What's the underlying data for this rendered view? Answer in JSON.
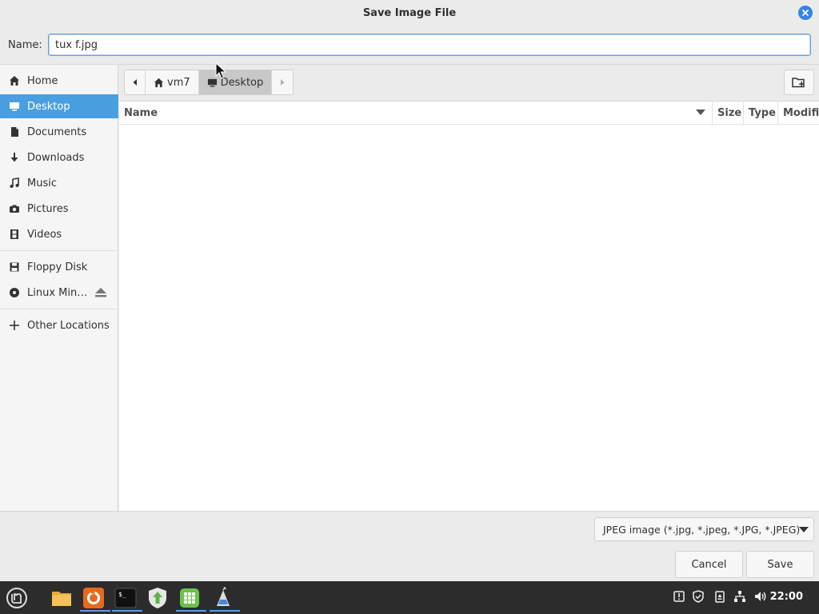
{
  "dialog": {
    "title": "Save Image File",
    "name_label": "Name:",
    "name_value": "tux f.jpg"
  },
  "sidebar": {
    "items": [
      {
        "label": "Home",
        "icon": "home-icon"
      },
      {
        "label": "Desktop",
        "icon": "desktop-icon",
        "active": true
      },
      {
        "label": "Documents",
        "icon": "documents-icon"
      },
      {
        "label": "Downloads",
        "icon": "downloads-icon"
      },
      {
        "label": "Music",
        "icon": "music-icon"
      },
      {
        "label": "Pictures",
        "icon": "camera-icon"
      },
      {
        "label": "Videos",
        "icon": "film-icon"
      }
    ],
    "devices": [
      {
        "label": "Floppy Disk",
        "icon": "floppy-icon"
      },
      {
        "label": "Linux Min…",
        "icon": "disc-icon",
        "eject": true
      }
    ],
    "other": {
      "label": "Other Locations",
      "icon": "plus-icon"
    }
  },
  "pathbar": {
    "segments": [
      {
        "label": "vm7",
        "icon": "home-icon"
      },
      {
        "label": "Desktop",
        "icon": "desktop-icon",
        "selected": true
      }
    ]
  },
  "columns": [
    "Name",
    "Size",
    "Type",
    "Modified"
  ],
  "filter": {
    "selected": "JPEG image (*.jpg, *.jpeg, *.JPG, *.JPEG)"
  },
  "buttons": {
    "cancel": "Cancel",
    "save": "Save"
  },
  "taskbar": {
    "apps": [
      "mint-menu-icon",
      "files-icon",
      "firefox-icon",
      "terminal-icon",
      "update-manager-icon",
      "calculator-icon",
      "image-editor-icon"
    ],
    "tray": [
      "notification-icon",
      "shield-icon",
      "clipboard-icon",
      "network-icon",
      "volume-icon"
    ],
    "clock": "22:00"
  },
  "colors": {
    "accent": "#4a9fe0",
    "close": "#3584e4",
    "taskbar": "#2c2c2c"
  }
}
